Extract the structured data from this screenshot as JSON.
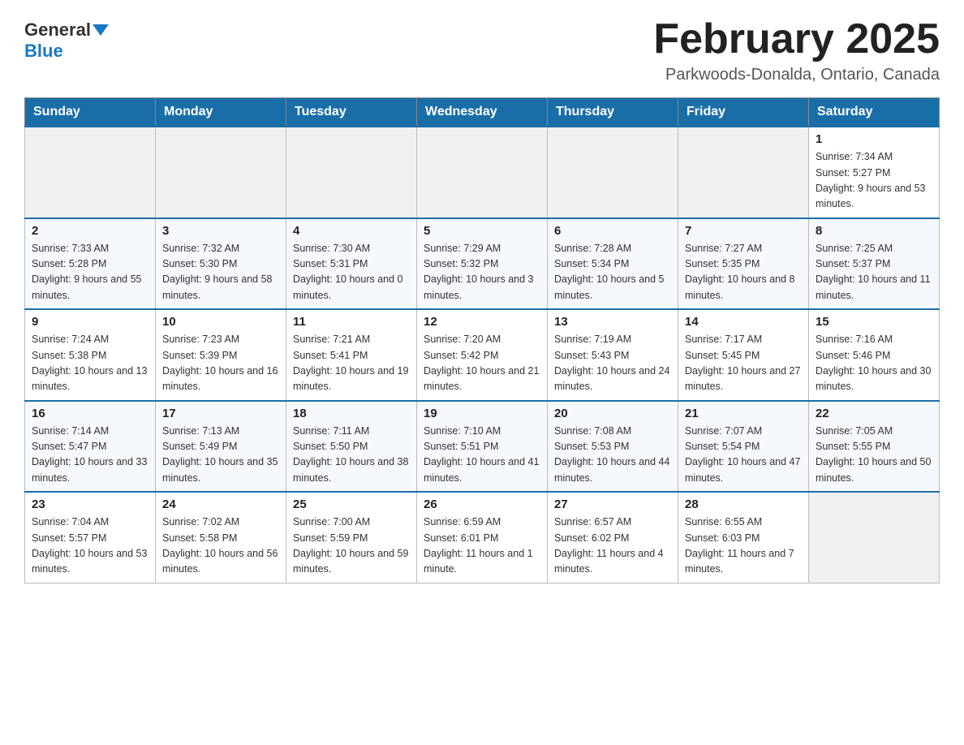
{
  "header": {
    "logo": {
      "general": "General",
      "blue": "Blue"
    },
    "title": "February 2025",
    "location": "Parkwoods-Donalda, Ontario, Canada"
  },
  "days_of_week": [
    "Sunday",
    "Monday",
    "Tuesday",
    "Wednesday",
    "Thursday",
    "Friday",
    "Saturday"
  ],
  "weeks": [
    {
      "days": [
        {
          "num": "",
          "info": ""
        },
        {
          "num": "",
          "info": ""
        },
        {
          "num": "",
          "info": ""
        },
        {
          "num": "",
          "info": ""
        },
        {
          "num": "",
          "info": ""
        },
        {
          "num": "",
          "info": ""
        },
        {
          "num": "1",
          "info": "Sunrise: 7:34 AM\nSunset: 5:27 PM\nDaylight: 9 hours and 53 minutes."
        }
      ]
    },
    {
      "days": [
        {
          "num": "2",
          "info": "Sunrise: 7:33 AM\nSunset: 5:28 PM\nDaylight: 9 hours and 55 minutes."
        },
        {
          "num": "3",
          "info": "Sunrise: 7:32 AM\nSunset: 5:30 PM\nDaylight: 9 hours and 58 minutes."
        },
        {
          "num": "4",
          "info": "Sunrise: 7:30 AM\nSunset: 5:31 PM\nDaylight: 10 hours and 0 minutes."
        },
        {
          "num": "5",
          "info": "Sunrise: 7:29 AM\nSunset: 5:32 PM\nDaylight: 10 hours and 3 minutes."
        },
        {
          "num": "6",
          "info": "Sunrise: 7:28 AM\nSunset: 5:34 PM\nDaylight: 10 hours and 5 minutes."
        },
        {
          "num": "7",
          "info": "Sunrise: 7:27 AM\nSunset: 5:35 PM\nDaylight: 10 hours and 8 minutes."
        },
        {
          "num": "8",
          "info": "Sunrise: 7:25 AM\nSunset: 5:37 PM\nDaylight: 10 hours and 11 minutes."
        }
      ]
    },
    {
      "days": [
        {
          "num": "9",
          "info": "Sunrise: 7:24 AM\nSunset: 5:38 PM\nDaylight: 10 hours and 13 minutes."
        },
        {
          "num": "10",
          "info": "Sunrise: 7:23 AM\nSunset: 5:39 PM\nDaylight: 10 hours and 16 minutes."
        },
        {
          "num": "11",
          "info": "Sunrise: 7:21 AM\nSunset: 5:41 PM\nDaylight: 10 hours and 19 minutes."
        },
        {
          "num": "12",
          "info": "Sunrise: 7:20 AM\nSunset: 5:42 PM\nDaylight: 10 hours and 21 minutes."
        },
        {
          "num": "13",
          "info": "Sunrise: 7:19 AM\nSunset: 5:43 PM\nDaylight: 10 hours and 24 minutes."
        },
        {
          "num": "14",
          "info": "Sunrise: 7:17 AM\nSunset: 5:45 PM\nDaylight: 10 hours and 27 minutes."
        },
        {
          "num": "15",
          "info": "Sunrise: 7:16 AM\nSunset: 5:46 PM\nDaylight: 10 hours and 30 minutes."
        }
      ]
    },
    {
      "days": [
        {
          "num": "16",
          "info": "Sunrise: 7:14 AM\nSunset: 5:47 PM\nDaylight: 10 hours and 33 minutes."
        },
        {
          "num": "17",
          "info": "Sunrise: 7:13 AM\nSunset: 5:49 PM\nDaylight: 10 hours and 35 minutes."
        },
        {
          "num": "18",
          "info": "Sunrise: 7:11 AM\nSunset: 5:50 PM\nDaylight: 10 hours and 38 minutes."
        },
        {
          "num": "19",
          "info": "Sunrise: 7:10 AM\nSunset: 5:51 PM\nDaylight: 10 hours and 41 minutes."
        },
        {
          "num": "20",
          "info": "Sunrise: 7:08 AM\nSunset: 5:53 PM\nDaylight: 10 hours and 44 minutes."
        },
        {
          "num": "21",
          "info": "Sunrise: 7:07 AM\nSunset: 5:54 PM\nDaylight: 10 hours and 47 minutes."
        },
        {
          "num": "22",
          "info": "Sunrise: 7:05 AM\nSunset: 5:55 PM\nDaylight: 10 hours and 50 minutes."
        }
      ]
    },
    {
      "days": [
        {
          "num": "23",
          "info": "Sunrise: 7:04 AM\nSunset: 5:57 PM\nDaylight: 10 hours and 53 minutes."
        },
        {
          "num": "24",
          "info": "Sunrise: 7:02 AM\nSunset: 5:58 PM\nDaylight: 10 hours and 56 minutes."
        },
        {
          "num": "25",
          "info": "Sunrise: 7:00 AM\nSunset: 5:59 PM\nDaylight: 10 hours and 59 minutes."
        },
        {
          "num": "26",
          "info": "Sunrise: 6:59 AM\nSunset: 6:01 PM\nDaylight: 11 hours and 1 minute."
        },
        {
          "num": "27",
          "info": "Sunrise: 6:57 AM\nSunset: 6:02 PM\nDaylight: 11 hours and 4 minutes."
        },
        {
          "num": "28",
          "info": "Sunrise: 6:55 AM\nSunset: 6:03 PM\nDaylight: 11 hours and 7 minutes."
        },
        {
          "num": "",
          "info": ""
        }
      ]
    }
  ]
}
